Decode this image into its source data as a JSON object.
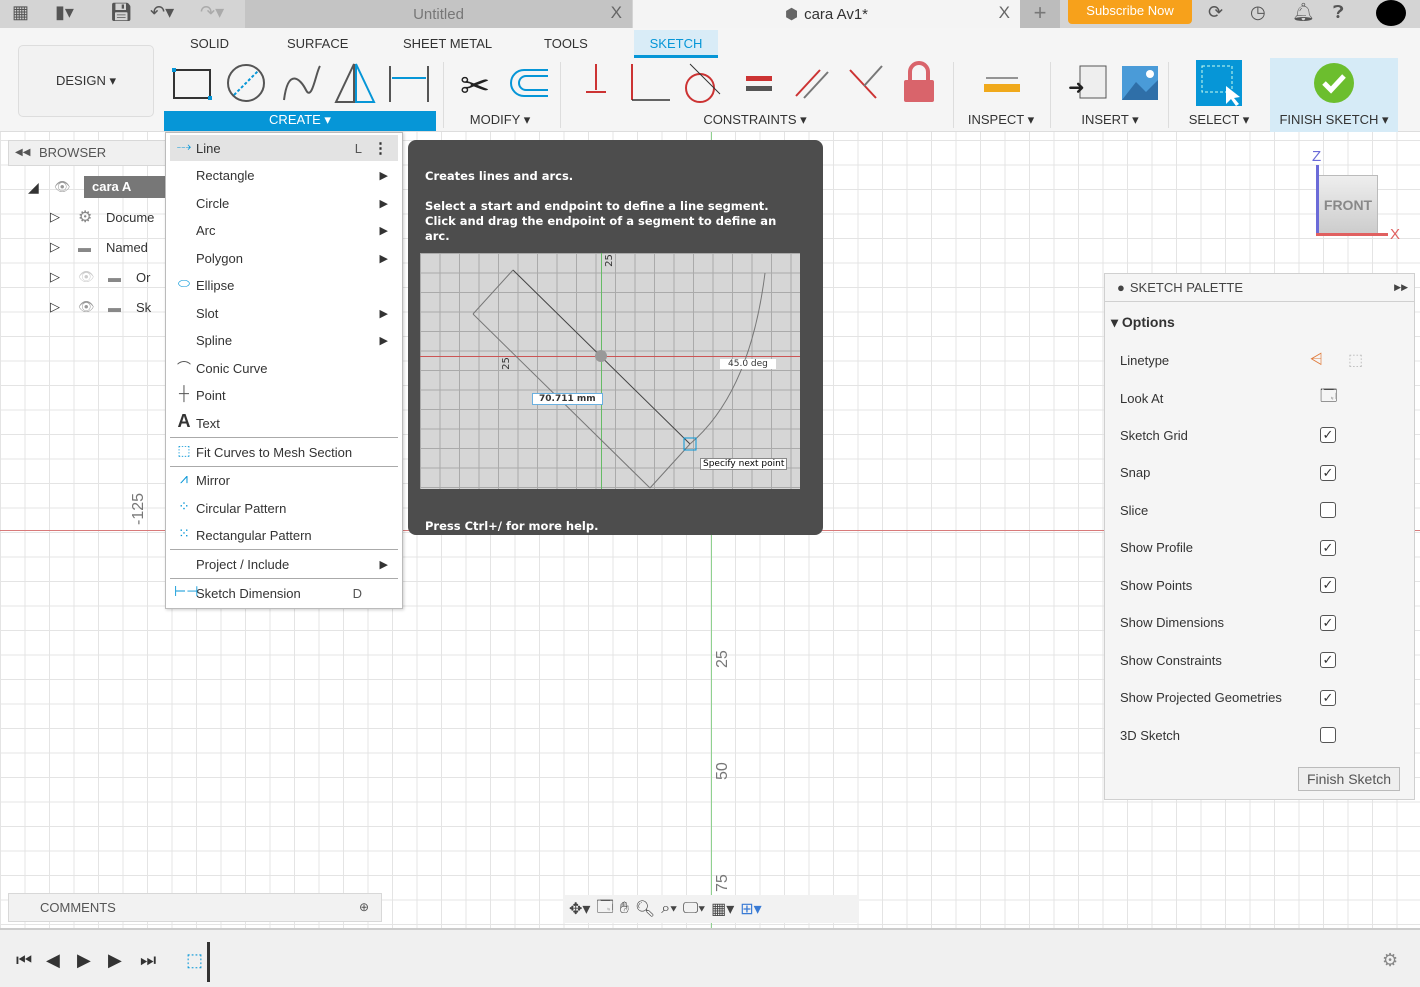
{
  "titlebar": {
    "tabs": [
      {
        "label": "Untitled",
        "close": "X"
      },
      {
        "label": "cara Av1*",
        "close": "X"
      }
    ],
    "new_tab": "+",
    "subscribe": "Subscribe Now"
  },
  "toolbar": {
    "workspace": "DESIGN ▾",
    "tabs": [
      "SOLID",
      "SURFACE",
      "SHEET METAL",
      "TOOLS",
      "SKETCH"
    ],
    "active_tab": "SKETCH",
    "groups": {
      "create": "CREATE ▾",
      "modify": "MODIFY ▾",
      "constraints": "CONSTRAINTS ▾",
      "inspect": "INSPECT ▾",
      "insert": "INSERT ▾",
      "select": "SELECT ▾",
      "finish": "FINISH SKETCH ▾"
    },
    "accent": "#0696d7",
    "finish_color": "#6cbe2e"
  },
  "browser": {
    "title": "BROWSER",
    "items": [
      {
        "label": "cara A",
        "icon": "component-icon"
      },
      {
        "label": "Docume",
        "icon": "gear-icon"
      },
      {
        "label": "Named ",
        "icon": "folder-icon"
      },
      {
        "label": "Or",
        "icon": "folder-icon"
      },
      {
        "label": "Sk",
        "icon": "folder-icon"
      }
    ]
  },
  "create_menu": {
    "items": [
      {
        "label": "Line",
        "shortcut": "L",
        "icon": "line-icon",
        "highlighted": true
      },
      {
        "label": "Rectangle",
        "submenu": true
      },
      {
        "label": "Circle",
        "submenu": true
      },
      {
        "label": "Arc",
        "submenu": true
      },
      {
        "label": "Polygon",
        "submenu": true
      },
      {
        "label": "Ellipse",
        "icon": "ellipse-icon"
      },
      {
        "label": "Slot",
        "submenu": true
      },
      {
        "label": "Spline",
        "submenu": true
      },
      {
        "label": "Conic Curve",
        "icon": "conic-icon"
      },
      {
        "label": "Point",
        "icon": "point-icon"
      },
      {
        "label": "Text",
        "icon": "text-icon"
      },
      {
        "label": "Fit Curves to Mesh Section",
        "icon": "fit-curves-icon"
      },
      {
        "label": "Mirror",
        "icon": "mirror-icon"
      },
      {
        "label": "Circular Pattern",
        "icon": "circular-pattern-icon"
      },
      {
        "label": "Rectangular Pattern",
        "icon": "rectangular-pattern-icon"
      },
      {
        "label": "Project / Include",
        "submenu": true
      },
      {
        "label": "Sketch Dimension",
        "shortcut": "D",
        "icon": "dimension-icon"
      }
    ]
  },
  "tooltip": {
    "title": "Creates lines and arcs.",
    "body": "Select a start and endpoint to define a line segment. Click and drag the endpoint of a segment to define an arc.",
    "image": {
      "length": "70.711 mm",
      "angle": "45.0 deg",
      "prompt": "Specify next point",
      "tick_v": "25",
      "tick_h": "25"
    },
    "footer": "Press Ctrl+/ for more help."
  },
  "viewcube": {
    "face": "FRONT",
    "z": "Z",
    "x": "X"
  },
  "canvas": {
    "rulers": [
      "-125",
      "25",
      "50",
      "75"
    ]
  },
  "palette": {
    "title": "SKETCH PALETTE",
    "section": "Options",
    "linetype": "Linetype",
    "look_at": "Look At",
    "options": [
      {
        "label": "Sketch Grid",
        "checked": true
      },
      {
        "label": "Snap",
        "checked": true
      },
      {
        "label": "Slice",
        "checked": false
      },
      {
        "label": "Show Profile",
        "checked": true
      },
      {
        "label": "Show Points",
        "checked": true
      },
      {
        "label": "Show Dimensions",
        "checked": true
      },
      {
        "label": "Show Constraints",
        "checked": true
      },
      {
        "label": "Show Projected Geometries",
        "checked": true
      },
      {
        "label": "3D Sketch",
        "checked": false
      }
    ],
    "finish": "Finish Sketch"
  },
  "comments": {
    "label": "COMMENTS"
  }
}
